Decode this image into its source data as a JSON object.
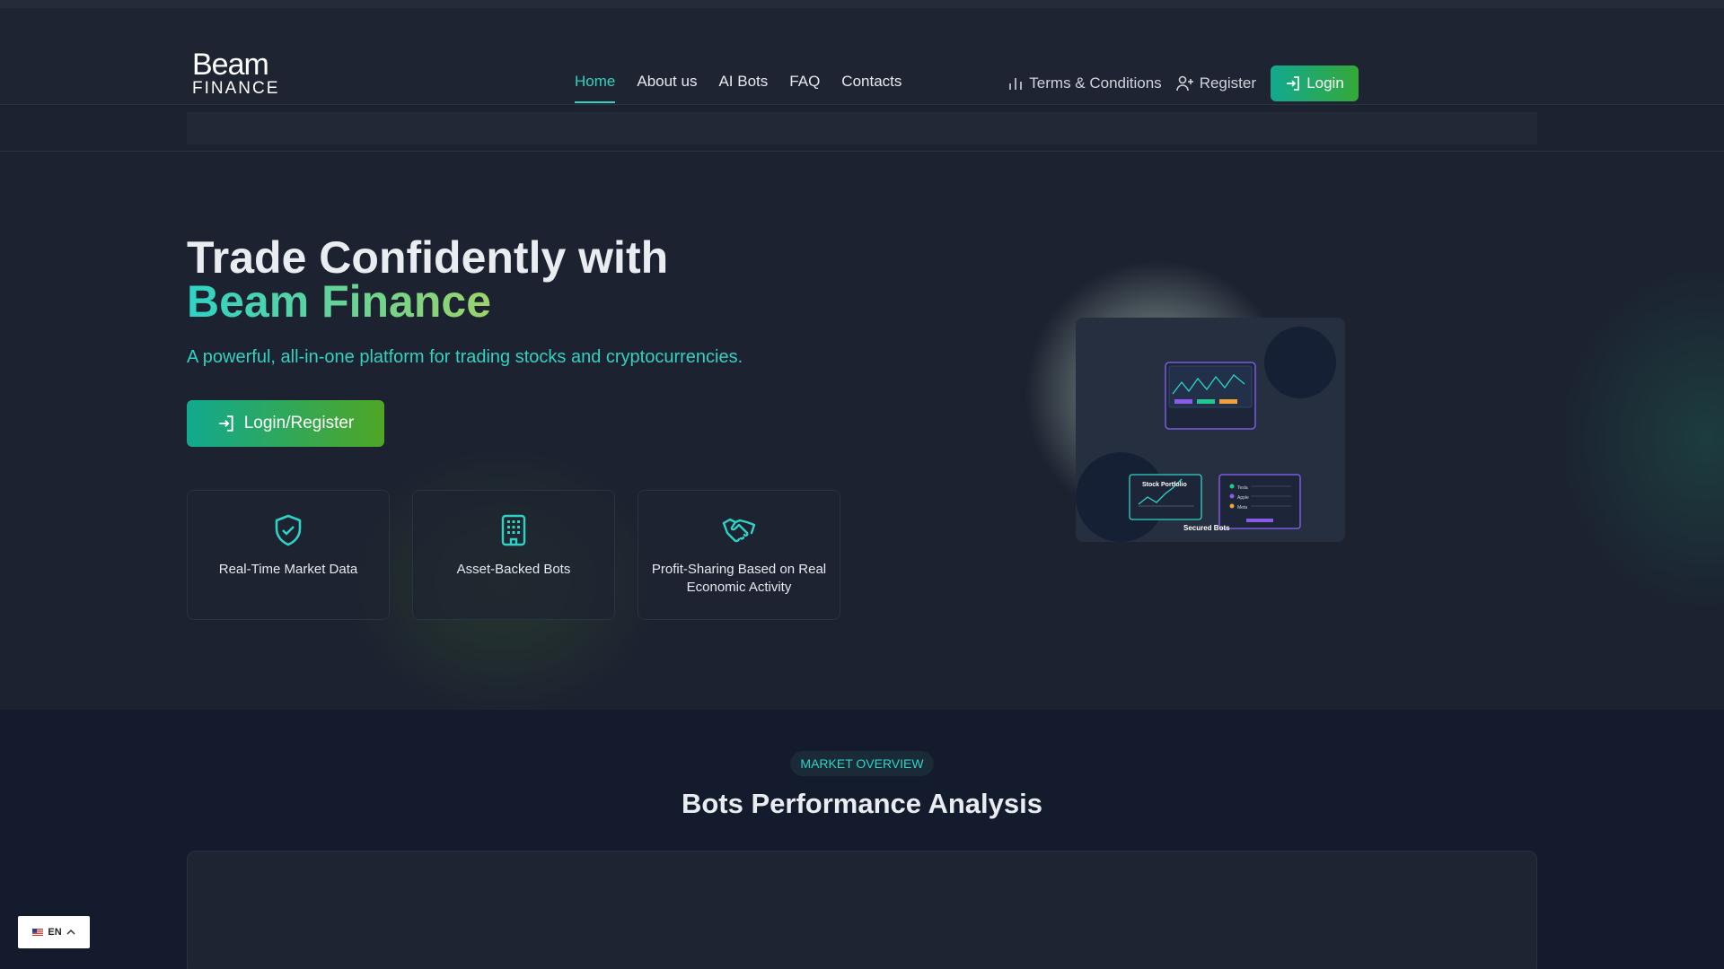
{
  "header": {
    "logo_line1": "Beam",
    "logo_line2": "FINANCE",
    "nav": [
      "Home",
      "About us",
      "AI Bots",
      "FAQ",
      "Contacts"
    ],
    "terms": "Terms & Conditions",
    "register": "Register",
    "login": "Login"
  },
  "hero": {
    "title_line1": "Trade Confidently with",
    "title_line2": "Beam Finance",
    "subtitle": "A powerful, all-in-one platform for trading stocks and cryptocurrencies.",
    "cta": "Login/Register",
    "features": [
      {
        "icon": "shield-check-icon",
        "label": "Real-Time Market Data"
      },
      {
        "icon": "building-icon",
        "label": "Asset-Backed Bots"
      },
      {
        "icon": "handshake-icon",
        "label": "Profit-Sharing Based on Real Economic Activity"
      }
    ],
    "illustration": {
      "portfolio_label": "Stock Portfolio",
      "secured_label": "Secured Bots",
      "list_items": [
        "Tesla",
        "Apple",
        "Meta"
      ]
    }
  },
  "market": {
    "badge": "MARKET OVERVIEW",
    "title": "Bots Performance Analysis"
  },
  "language": {
    "code": "EN"
  },
  "colors": {
    "accent": "#2ed3c6",
    "button_gradient_start": "#11a98f",
    "button_gradient_end": "#4fa626",
    "background": "#1c2230"
  }
}
